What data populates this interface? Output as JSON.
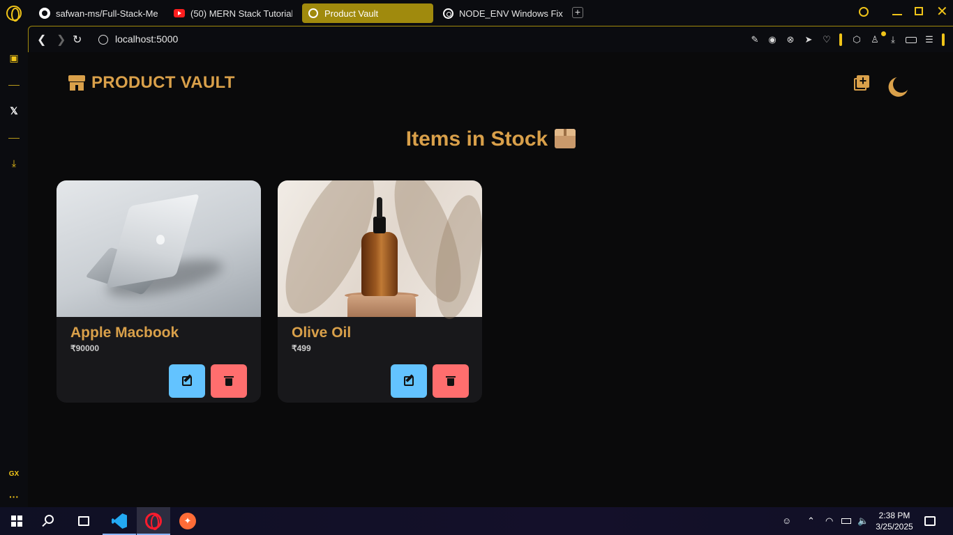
{
  "browser": {
    "tabs": [
      {
        "title": "safwan-ms/Full-Stack-Me",
        "icon": "github-icon"
      },
      {
        "title": "(50) MERN Stack Tutorial",
        "icon": "youtube-icon"
      },
      {
        "title": "Product Vault",
        "icon": "globe-icon",
        "active": true
      },
      {
        "title": "NODE_ENV Windows Fix",
        "icon": "chatgpt-icon"
      }
    ],
    "url": "localhost:5000",
    "accent_color": "#f0c419"
  },
  "sidebar": {
    "gx_label": "GX"
  },
  "app": {
    "brand": "PRODUCT VAULT",
    "heading": "Items in Stock",
    "accent_color": "#d9a04a",
    "products": [
      {
        "name": "Apple Macbook",
        "price": "₹90000",
        "image": "laptop"
      },
      {
        "name": "Olive Oil",
        "price": "₹499",
        "image": "oil-bottle"
      }
    ],
    "edit_button_color": "#63c3ff",
    "delete_button_color": "#ff6e6e"
  },
  "taskbar": {
    "time": "2:38 PM",
    "date": "3/25/2025"
  }
}
